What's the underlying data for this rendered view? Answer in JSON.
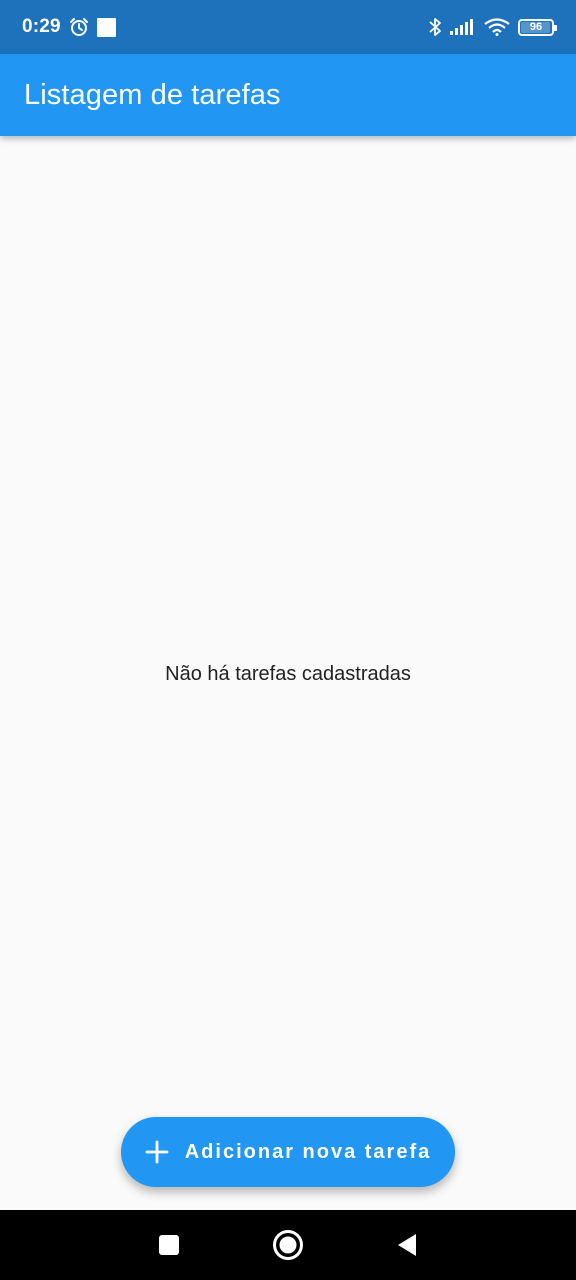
{
  "status_bar": {
    "time": "0:29",
    "battery_level": "96",
    "icons": [
      "alarm-icon",
      "notification-square-icon",
      "bluetooth-icon",
      "signal-icon",
      "wifi-icon",
      "battery-icon"
    ]
  },
  "app_bar": {
    "title": "Listagem de tarefas"
  },
  "main": {
    "empty_message": "Não há tarefas cadastradas"
  },
  "fab": {
    "icon": "plus-icon",
    "label": "Adicionar nova tarefa"
  },
  "nav_bar": {
    "buttons": [
      "recents-square-icon",
      "home-circle-icon",
      "back-triangle-icon"
    ]
  },
  "colors": {
    "status_bar": "#1e72bb",
    "primary": "#2196f3",
    "background": "#fafafa",
    "nav_bar": "#000000"
  }
}
